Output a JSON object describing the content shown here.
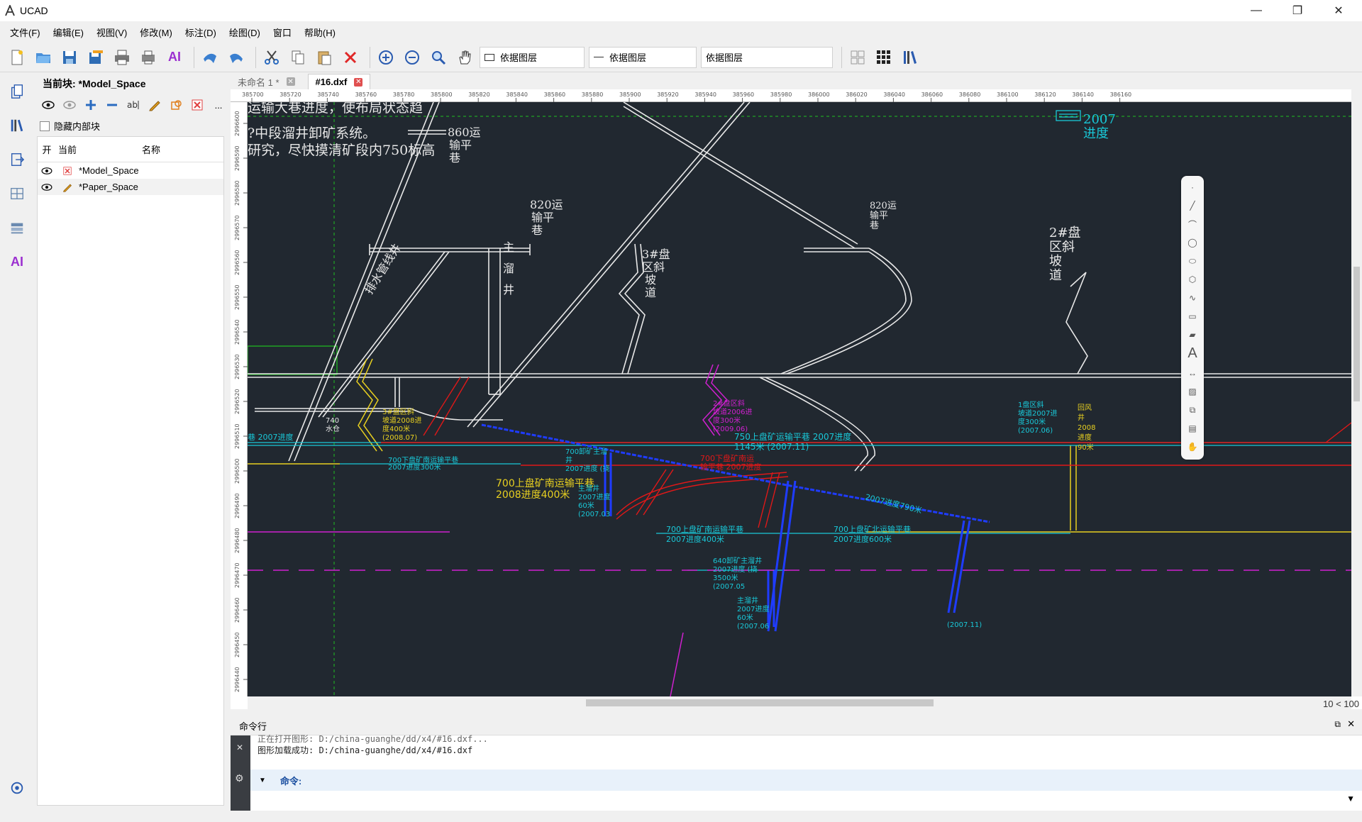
{
  "window": {
    "title": "UCAD",
    "controls": [
      "minimize",
      "restore",
      "close"
    ]
  },
  "menu": [
    "文件(F)",
    "编辑(E)",
    "视图(V)",
    "修改(M)",
    "标注(D)",
    "绘图(D)",
    "窗口",
    "帮助(H)"
  ],
  "toolbar": {
    "layer_combo_1": "依据图层",
    "layer_combo_2": "依据图层",
    "layer_combo_3": "依据图层",
    "ai_label": "AI"
  },
  "left_strip": {
    "ai_label": "AI"
  },
  "block_panel": {
    "current_block_label": "当前块: *Model_Space",
    "hide_internal_label": "隐藏内部块",
    "more_label": "...",
    "columns": {
      "on": "开",
      "current": "当前",
      "name": "名称"
    },
    "rows": [
      {
        "name": "*Model_Space"
      },
      {
        "name": "*Paper_Space"
      }
    ]
  },
  "tabs": [
    {
      "label": "未命名 1 *"
    },
    {
      "label": "#16.dxf"
    }
  ],
  "ruler": {
    "x_ticks": [
      "385700",
      "385720",
      "385740",
      "385760",
      "385780",
      "385800",
      "385820",
      "385840",
      "385860",
      "385880",
      "385900",
      "385920",
      "385940",
      "385960",
      "385980",
      "386000",
      "386020",
      "386040",
      "386060",
      "386080",
      "386100",
      "386120",
      "386140",
      "386160"
    ],
    "y_ticks": [
      "2996600",
      "2996590",
      "2996580",
      "2996570",
      "2996560",
      "2996550",
      "2996540",
      "2996530",
      "2996520",
      "2996510",
      "2996500",
      "2996490",
      "2996480",
      "2996470",
      "2996460",
      "2996450",
      "2996440"
    ]
  },
  "drawing_text": {
    "t1": "运输大巷进度，使布局状态趋",
    "t2": "?中段溜井卸矿系统。",
    "t3": "研究，尽快摸清矿段内750标高",
    "t4": "860运",
    "t5": "输平",
    "t6": "巷",
    "t7": "820运",
    "t8": "输平",
    "t9": "巷",
    "t10": "主",
    "t11": "溜",
    "t12": "井",
    "t13": "3#盘",
    "t14": "区斜",
    "t15": "坡",
    "t16": "道",
    "t17": "820运",
    "t18": "输平",
    "t19": "巷",
    "t20": "2#盘",
    "t21": "区斜",
    "t22": "坡",
    "t23": "道",
    "t24": "2007",
    "t25": "进度",
    "t26": "排水管线井",
    "t27": "2#盘区斜",
    "t28": "坡道2006进",
    "t29": "度300米",
    "t30": "(2009.06)",
    "t31": "3#盘区斜",
    "t32": "坡道2008进",
    "t33": "度400米",
    "t34": "(2008.07)",
    "t35": "750上盘矿运输平巷  2007进度",
    "t36": "1145米 (2007.11)",
    "t37": "700下盘矿南运输平巷",
    "t38": "2007进度300米",
    "t39": "700卸矿主溜",
    "t40": "井",
    "t41": "2007进度 (挠",
    "t42": "700下盘矿南运",
    "t43": "输平巷 2007进度",
    "t44": "700上盘矿南运输平巷",
    "t45": "2008进度400米",
    "t46": "700上盘矿南运输平巷",
    "t47": "2007进度400米",
    "t48": "700上盘矿北运输平巷",
    "t49": "2007进度600米",
    "t50": "2007进度790米",
    "t51": "640卸矿主溜井",
    "t52": "2007进度 (挠",
    "t53": "3500米",
    "t54": "(2007.05",
    "t55": "主溜井",
    "t56": "2007进度",
    "t57": "60米",
    "t58": "(2007.06",
    "t59": "回风",
    "t60": "井",
    "t61": "2008",
    "t62": "进度",
    "t63": "90米",
    "t64": "1盘区斜",
    "t65": "坡道2007进",
    "t66": "度300米",
    "t67": "(2007.06)",
    "t68": "740",
    "t69": "水仓",
    "t70": "巷  2007进度",
    "t71": "(2007.11)",
    "t72": "主溜井",
    "t73": "2007进度",
    "t74": "60米",
    "t75": "(2007.03"
  },
  "status": {
    "zoom": "10 < 100"
  },
  "command": {
    "title": "命令行",
    "line1": "正在打开图形: D:/china-guanghe/dd/x4/#16.dxf...",
    "line2": "图形加载成功: D:/china-guanghe/dd/x4/#16.dxf",
    "prompt": "命令:"
  },
  "colors": {
    "canvas_bg": "#212830",
    "white_line": "#e8e8e8",
    "cyan": "#19c8d8",
    "red": "#e01818",
    "blue": "#1f3cff",
    "yellow": "#e8d020",
    "magenta": "#d020d0",
    "green": "#20c020"
  }
}
